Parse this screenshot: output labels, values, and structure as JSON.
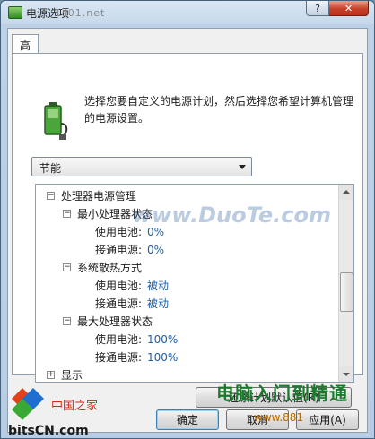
{
  "window": {
    "title": "电源选项",
    "bg_text": "1s01.net",
    "help_button": "?",
    "close_button": "✕"
  },
  "tabs": [
    {
      "label": "高级设置",
      "active": true
    }
  ],
  "description": "选择您要自定义的电源计划，然后选择您希望计算机管理的电源设置。",
  "plan_select": {
    "value": "节能"
  },
  "tree": {
    "rows": [
      {
        "level": 0,
        "expander": "−",
        "label": "处理器电源管理"
      },
      {
        "level": 1,
        "expander": "−",
        "label": "最小处理器状态"
      },
      {
        "level": 2,
        "label": "使用电池:",
        "value": "0%"
      },
      {
        "level": 2,
        "label": "接通电源:",
        "value": "0%"
      },
      {
        "level": 1,
        "expander": "−",
        "label": "系统散热方式"
      },
      {
        "level": 2,
        "label": "使用电池:",
        "value": "被动"
      },
      {
        "level": 2,
        "label": "接通电源:",
        "value": "被动"
      },
      {
        "level": 1,
        "expander": "−",
        "label": "最大处理器状态"
      },
      {
        "level": 2,
        "label": "使用电池:",
        "value": "100%"
      },
      {
        "level": 2,
        "label": "接通电源:",
        "value": "100%"
      },
      {
        "level": 0,
        "expander": "+",
        "label": "显示"
      }
    ]
  },
  "buttons": {
    "restore": "还原计划默认值(R)",
    "ok": "确定",
    "cancel": "取消",
    "apply": "应用(A)"
  },
  "watermarks": {
    "mid": "www.DuoTe.com",
    "cn": "电脑入门到精通",
    "url": "www.881",
    "logo_site": "bitsCN.com",
    "logo_cn": "中国之家"
  },
  "colors": {
    "value_text": "#1b5fa6",
    "titlebar": "#c6d8ea",
    "close": "#c7422a"
  }
}
